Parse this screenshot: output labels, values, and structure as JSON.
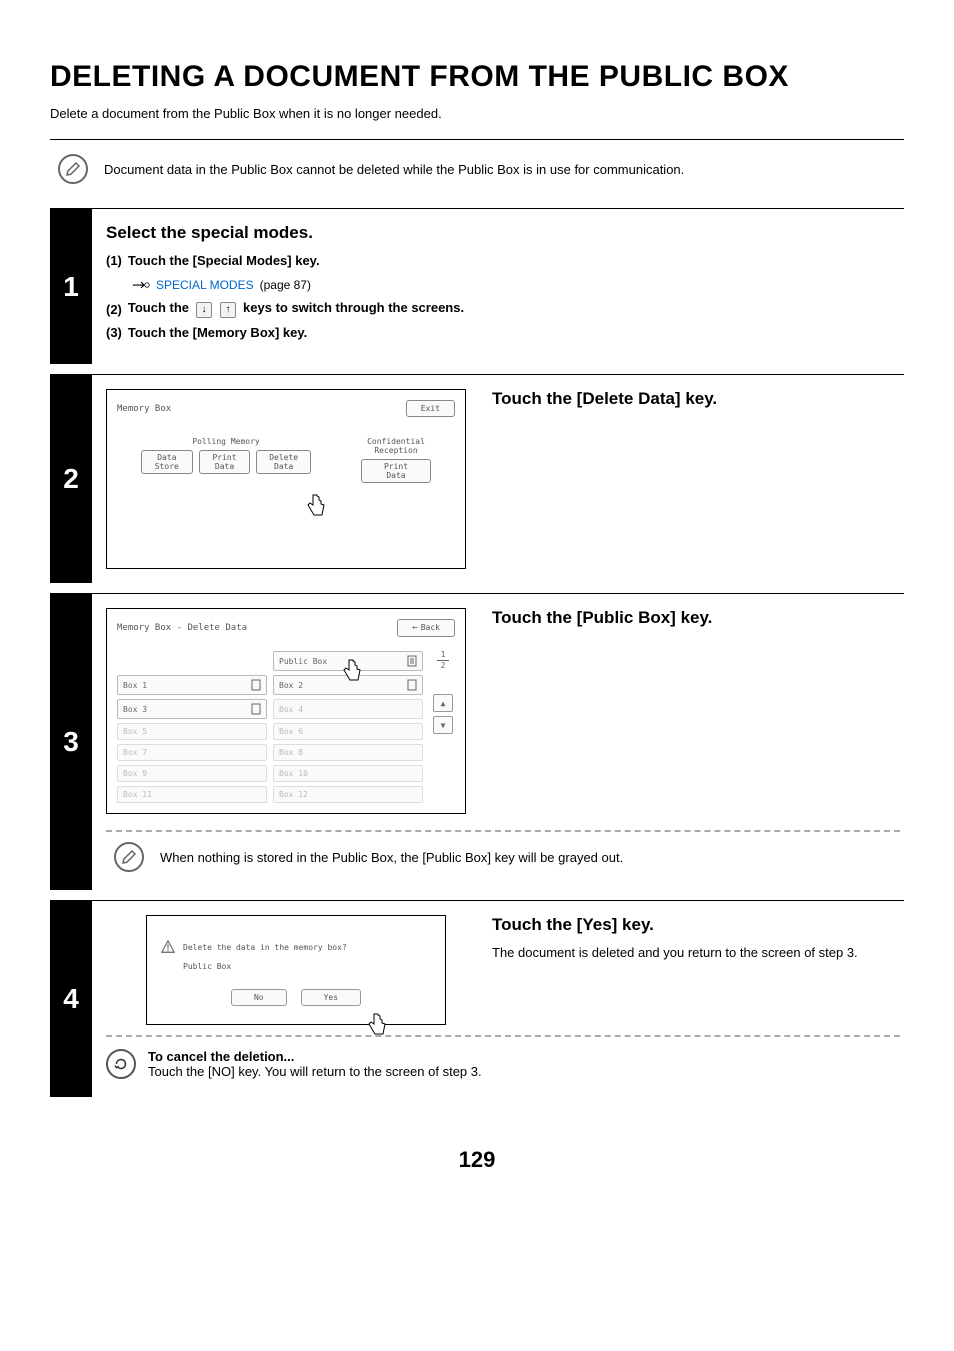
{
  "title": "DELETING A DOCUMENT FROM THE PUBLIC BOX",
  "intro": "Delete a document from the Public Box when it is no longer needed.",
  "note1": "Document data in the Public Box cannot be deleted while the Public Box is in use for communication.",
  "step1": {
    "num": "1",
    "title": "Select the special modes.",
    "s1_idx": "(1)",
    "s1": "Touch the [Special Modes] key.",
    "ref_link": "SPECIAL MODES",
    "ref_page": "(page 87)",
    "s2_idx": "(2)",
    "s2_a": "Touch the ",
    "s2_b": " keys to switch through the screens.",
    "s3_idx": "(3)",
    "s3": "Touch the [Memory Box] key."
  },
  "step2": {
    "num": "2",
    "title": "Touch the [Delete Data] key.",
    "panel_title": "Memory Box",
    "exit": "Exit",
    "polling": "Polling Memory",
    "conf": "Confidential\nReception",
    "data_store": "Data Store",
    "print_data": "Print Data",
    "delete_data": "Delete Data"
  },
  "step3": {
    "num": "3",
    "title": "Touch the [Public Box] key.",
    "panel_title": "Memory Box - Delete Data",
    "back": "Back",
    "public_box": "Public Box",
    "boxes": [
      "Box 1",
      "Box 2",
      "Box 3",
      "Box 4",
      "Box 5",
      "Box 6",
      "Box 7",
      "Box 8",
      "Box 9",
      "Box 10",
      "Box 11",
      "Box 12"
    ],
    "pager_top": "1",
    "pager_bot": "2",
    "note": "When nothing is stored in the Public Box, the [Public Box] key will be grayed out."
  },
  "step4": {
    "num": "4",
    "title": "Touch the [Yes] key.",
    "desc": "The document is deleted and you return to the screen of step 3.",
    "warn": "Delete the data in the memory box?",
    "box_label": "Public Box",
    "no": "No",
    "yes": "Yes",
    "cancel_title": "To cancel the deletion...",
    "cancel_body": "Touch the [NO] key. You will return to the screen of step 3."
  },
  "page_number": "129"
}
